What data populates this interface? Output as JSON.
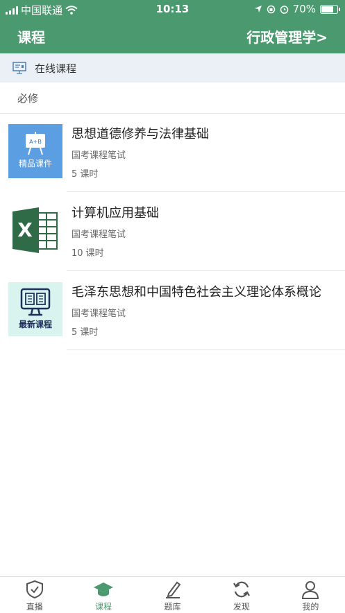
{
  "status": {
    "carrier": "中国联通",
    "time": "10:13",
    "battery": "70%"
  },
  "nav": {
    "title": "课程",
    "major": "行政管理学>"
  },
  "section": {
    "title": "在线课程"
  },
  "group": {
    "label": "必修"
  },
  "courses": [
    {
      "title": "思想道德修养与法律基础",
      "subtitle": "国考课程笔试",
      "hours": "5 课时",
      "thumb_text": "精品课件",
      "thumb_board": "A+B",
      "thumb_icon": "whiteboard-icon"
    },
    {
      "title": "计算机应用基础",
      "subtitle": "国考课程笔试",
      "hours": "10 课时",
      "thumb_letter": "X",
      "thumb_icon": "excel-icon"
    },
    {
      "title": "毛泽东思想和中国特色社会主义理论体系概论",
      "subtitle": "国考课程笔试",
      "hours": "5 课时",
      "thumb_text": "最新课程",
      "thumb_icon": "monitor-book-icon"
    }
  ],
  "tabs": [
    {
      "label": "直播",
      "icon": "shield-check-icon"
    },
    {
      "label": "课程",
      "icon": "graduation-cap-icon"
    },
    {
      "label": "题库",
      "icon": "pencil-icon"
    },
    {
      "label": "发现",
      "icon": "refresh-icon"
    },
    {
      "label": "我的",
      "icon": "person-icon"
    }
  ],
  "colors": {
    "primary": "#4b9a6f",
    "section_bg": "#eaf0f6",
    "tab_inactive": "#555555"
  }
}
